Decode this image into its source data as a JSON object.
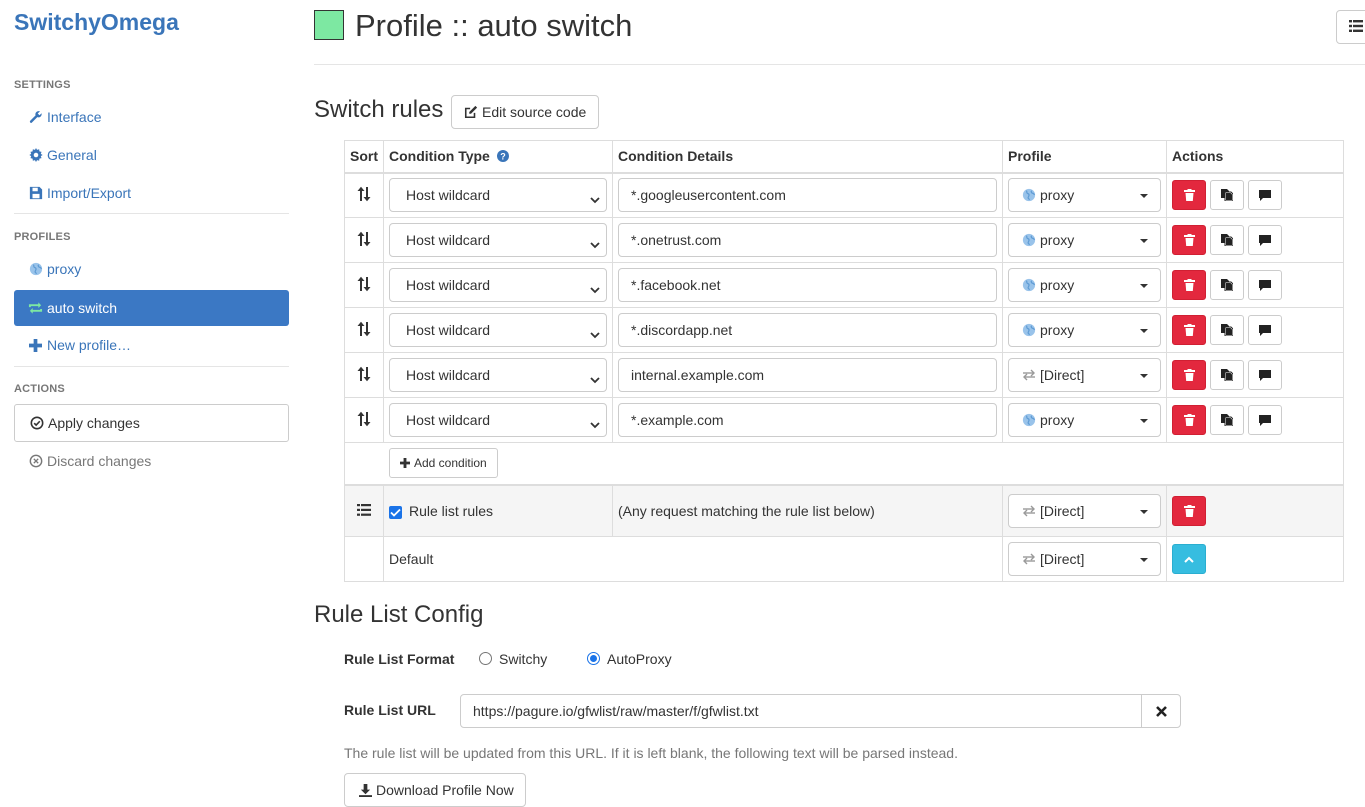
{
  "sidebar": {
    "brand": "SwitchyOmega",
    "settings_header": "SETTINGS",
    "settings_items": [
      {
        "label": "Interface",
        "icon": "wrench-icon"
      },
      {
        "label": "General",
        "icon": "gear-icon"
      },
      {
        "label": "Import/Export",
        "icon": "floppy-icon"
      }
    ],
    "profiles_header": "PROFILES",
    "profile_items": [
      {
        "label": "proxy",
        "icon": "globe-icon"
      },
      {
        "label": "auto switch",
        "icon": "switch-icon",
        "active": true
      },
      {
        "label": "New profile…",
        "icon": "plus-icon"
      }
    ],
    "actions_header": "ACTIONS",
    "apply_label": "Apply changes",
    "discard_label": "Discard changes"
  },
  "header": {
    "title": "Profile :: auto switch",
    "swatch_color": "#7de8a2"
  },
  "switch_rules": {
    "title": "Switch rules",
    "edit_source_label": "Edit source code",
    "columns": [
      "Sort",
      "Condition Type",
      "Condition Details",
      "Profile",
      "Actions"
    ],
    "rules": [
      {
        "condition_type": "Host wildcard",
        "details": "*.googleusercontent.com",
        "profile": "proxy",
        "profile_icon": "globe-icon"
      },
      {
        "condition_type": "Host wildcard",
        "details": "*.onetrust.com",
        "profile": "proxy",
        "profile_icon": "globe-icon"
      },
      {
        "condition_type": "Host wildcard",
        "details": "*.facebook.net",
        "profile": "proxy",
        "profile_icon": "globe-icon"
      },
      {
        "condition_type": "Host wildcard",
        "details": "*.discordapp.net",
        "profile": "proxy",
        "profile_icon": "globe-icon"
      },
      {
        "condition_type": "Host wildcard",
        "details": "internal.example.com",
        "profile": "[Direct]",
        "profile_icon": "direct-icon"
      },
      {
        "condition_type": "Host wildcard",
        "details": "*.example.com",
        "profile": "proxy",
        "profile_icon": "globe-icon"
      }
    ],
    "add_condition_label": "Add condition",
    "rule_list": {
      "label": "Rule list rules",
      "checked": true,
      "details": "(Any request matching the rule list below)",
      "profile": "[Direct]"
    },
    "default": {
      "label": "Default",
      "profile": "[Direct]"
    }
  },
  "rule_list_config": {
    "title": "Rule List Config",
    "format_label": "Rule List Format",
    "format_options": [
      "Switchy",
      "AutoProxy"
    ],
    "format_selected": "AutoProxy",
    "url_label": "Rule List URL",
    "url_value": "https://pagure.io/gfwlist/raw/master/f/gfwlist.txt",
    "help_text": "The rule list will be updated from this URL. If it is left blank, the following text will be parsed instead.",
    "download_label": "Download Profile Now"
  },
  "colors": {
    "accent": "#3b78c4",
    "danger": "#e3283e",
    "info": "#36bde0"
  }
}
